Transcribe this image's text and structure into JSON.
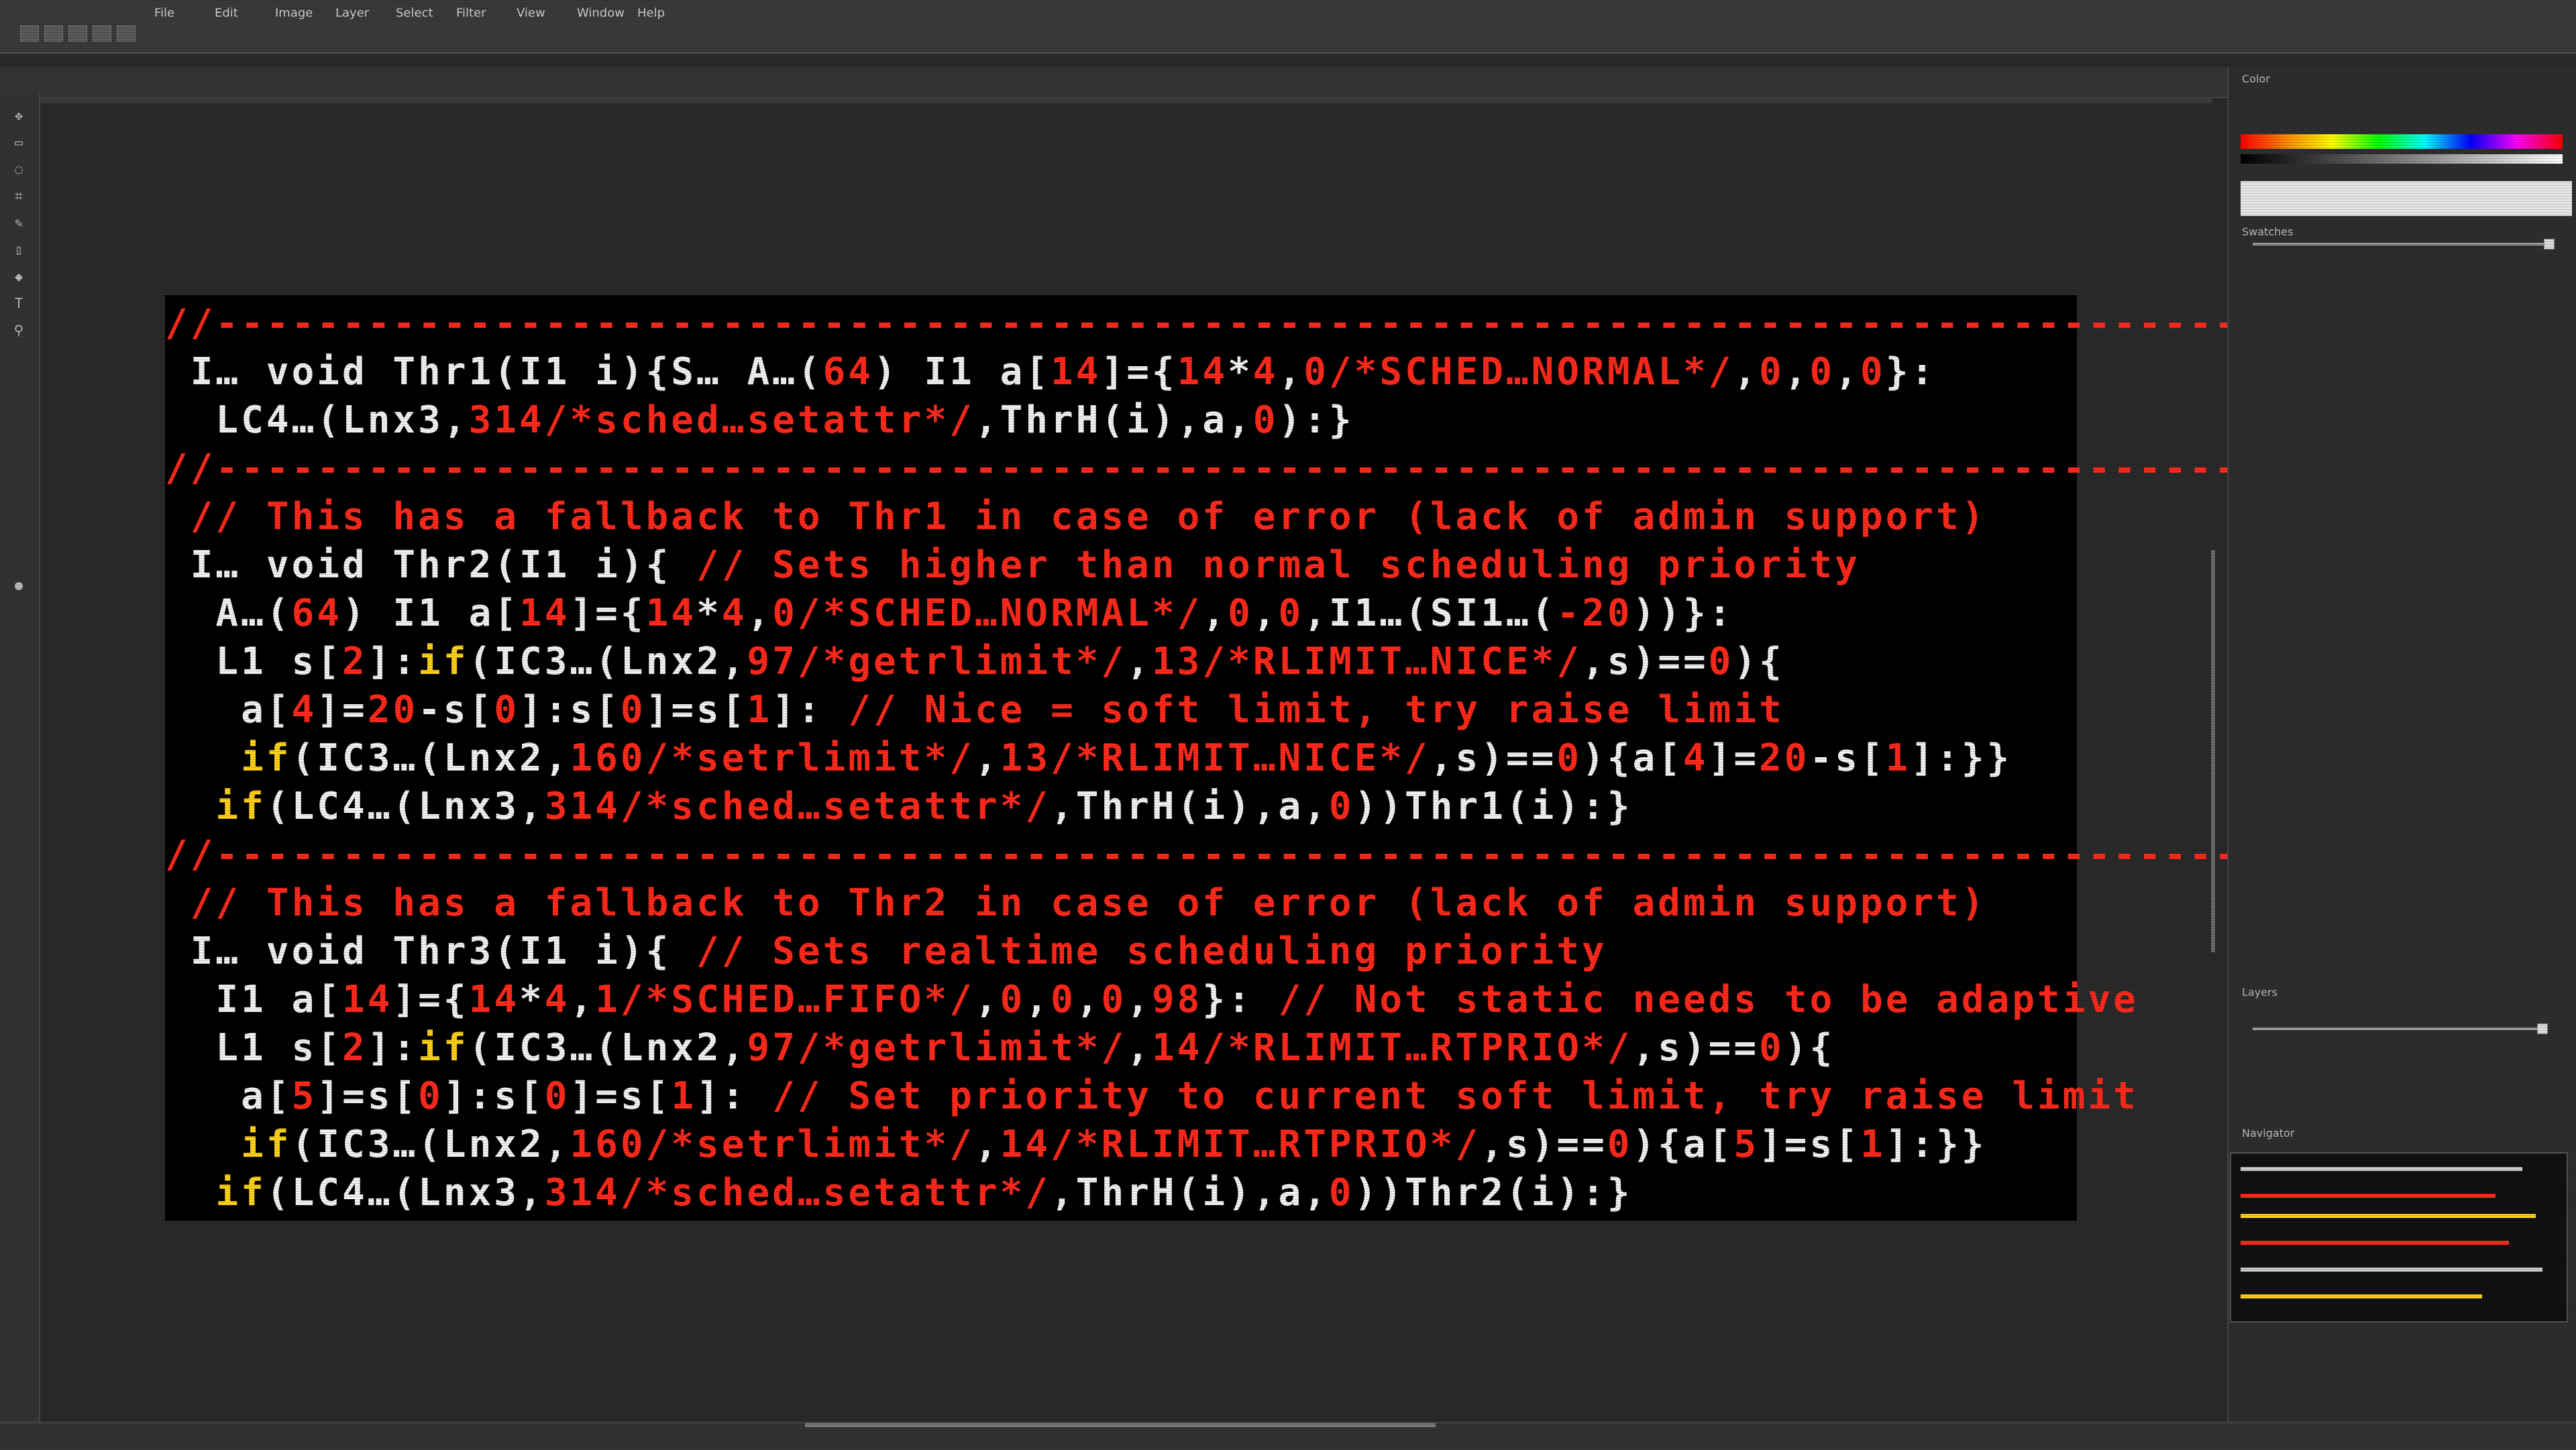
{
  "app": {
    "menu": [
      "File",
      "Edit",
      "Image",
      "Layer",
      "Select",
      "Filter",
      "View",
      "Window",
      "Help"
    ]
  },
  "panels": {
    "color": "Color",
    "swatches": "Swatches",
    "layers": "Layers",
    "navigator": "Navigator"
  },
  "colors": {
    "comment": "#ff2a1c",
    "keyword": "#ffd21a",
    "text": "#f2f2f2",
    "canvas_bg": "#000000",
    "app_bg": "#2a2a2a"
  },
  "code": {
    "lines": [
      [
        {
          "c": "r",
          "t": "//-------------------------------------------------------------------------------------"
        }
      ],
      [
        {
          "c": "w",
          "t": " I… void Thr1(I1 i){S… A…("
        },
        {
          "c": "r",
          "t": "64"
        },
        {
          "c": "w",
          "t": ") I1 a["
        },
        {
          "c": "r",
          "t": "14"
        },
        {
          "c": "w",
          "t": "]={"
        },
        {
          "c": "r",
          "t": "14"
        },
        {
          "c": "w",
          "t": "*"
        },
        {
          "c": "r",
          "t": "4"
        },
        {
          "c": "w",
          "t": ","
        },
        {
          "c": "r",
          "t": "0/*SCHED…NORMAL*/"
        },
        {
          "c": "w",
          "t": ","
        },
        {
          "c": "r",
          "t": "0"
        },
        {
          "c": "w",
          "t": ","
        },
        {
          "c": "r",
          "t": "0"
        },
        {
          "c": "w",
          "t": ","
        },
        {
          "c": "r",
          "t": "0"
        },
        {
          "c": "w",
          "t": "}:"
        }
      ],
      [
        {
          "c": "w",
          "t": "  LC4…(Lnx3,"
        },
        {
          "c": "r",
          "t": "314/*sched…setattr*/"
        },
        {
          "c": "w",
          "t": ",ThrH(i),a,"
        },
        {
          "c": "r",
          "t": "0"
        },
        {
          "c": "w",
          "t": "):}"
        }
      ],
      [
        {
          "c": "r",
          "t": "//-------------------------------------------------------------------------------------"
        }
      ],
      [
        {
          "c": "r",
          "t": " // This has a fallback to Thr1 in case of error (lack of admin support)"
        }
      ],
      [
        {
          "c": "w",
          "t": " I… void Thr2(I1 i){ "
        },
        {
          "c": "r",
          "t": "// Sets higher than normal scheduling priority"
        }
      ],
      [
        {
          "c": "w",
          "t": "  A…("
        },
        {
          "c": "r",
          "t": "64"
        },
        {
          "c": "w",
          "t": ") I1 a["
        },
        {
          "c": "r",
          "t": "14"
        },
        {
          "c": "w",
          "t": "]={"
        },
        {
          "c": "r",
          "t": "14"
        },
        {
          "c": "w",
          "t": "*"
        },
        {
          "c": "r",
          "t": "4"
        },
        {
          "c": "w",
          "t": ","
        },
        {
          "c": "r",
          "t": "0/*SCHED…NORMAL*/"
        },
        {
          "c": "w",
          "t": ","
        },
        {
          "c": "r",
          "t": "0"
        },
        {
          "c": "w",
          "t": ","
        },
        {
          "c": "r",
          "t": "0"
        },
        {
          "c": "w",
          "t": ",I1…(SI1…("
        },
        {
          "c": "r",
          "t": "-20"
        },
        {
          "c": "w",
          "t": "))}:"
        }
      ],
      [
        {
          "c": "w",
          "t": "  L1 s["
        },
        {
          "c": "r",
          "t": "2"
        },
        {
          "c": "w",
          "t": "]:"
        },
        {
          "c": "y",
          "t": "if"
        },
        {
          "c": "w",
          "t": "(IC3…(Lnx2,"
        },
        {
          "c": "r",
          "t": "97/*getrlimit*/"
        },
        {
          "c": "w",
          "t": ","
        },
        {
          "c": "r",
          "t": "13/*RLIMIT…NICE*/"
        },
        {
          "c": "w",
          "t": ",s)=="
        },
        {
          "c": "r",
          "t": "0"
        },
        {
          "c": "w",
          "t": "){"
        }
      ],
      [
        {
          "c": "w",
          "t": "   a["
        },
        {
          "c": "r",
          "t": "4"
        },
        {
          "c": "w",
          "t": "]="
        },
        {
          "c": "r",
          "t": "20"
        },
        {
          "c": "w",
          "t": "-s["
        },
        {
          "c": "r",
          "t": "0"
        },
        {
          "c": "w",
          "t": "]:s["
        },
        {
          "c": "r",
          "t": "0"
        },
        {
          "c": "w",
          "t": "]=s["
        },
        {
          "c": "r",
          "t": "1"
        },
        {
          "c": "w",
          "t": "]: "
        },
        {
          "c": "r",
          "t": "// Nice = soft limit, try raise limit"
        }
      ],
      [
        {
          "c": "y",
          "t": "   if"
        },
        {
          "c": "w",
          "t": "(IC3…(Lnx2,"
        },
        {
          "c": "r",
          "t": "160/*setrlimit*/"
        },
        {
          "c": "w",
          "t": ","
        },
        {
          "c": "r",
          "t": "13/*RLIMIT…NICE*/"
        },
        {
          "c": "w",
          "t": ",s)=="
        },
        {
          "c": "r",
          "t": "0"
        },
        {
          "c": "w",
          "t": "){a["
        },
        {
          "c": "r",
          "t": "4"
        },
        {
          "c": "w",
          "t": "]="
        },
        {
          "c": "r",
          "t": "20"
        },
        {
          "c": "w",
          "t": "-s["
        },
        {
          "c": "r",
          "t": "1"
        },
        {
          "c": "w",
          "t": "]:}}"
        }
      ],
      [
        {
          "c": "y",
          "t": "  if"
        },
        {
          "c": "w",
          "t": "(LC4…(Lnx3,"
        },
        {
          "c": "r",
          "t": "314/*sched…setattr*/"
        },
        {
          "c": "w",
          "t": ",ThrH(i),a,"
        },
        {
          "c": "r",
          "t": "0"
        },
        {
          "c": "w",
          "t": "))Thr1(i):}"
        }
      ],
      [
        {
          "c": "r",
          "t": "//-------------------------------------------------------------------------------------"
        }
      ],
      [
        {
          "c": "r",
          "t": " // This has a fallback to Thr2 in case of error (lack of admin support)"
        }
      ],
      [
        {
          "c": "w",
          "t": " I… void Thr3(I1 i){ "
        },
        {
          "c": "r",
          "t": "// Sets realtime scheduling priority"
        }
      ],
      [
        {
          "c": "w",
          "t": "  I1 a["
        },
        {
          "c": "r",
          "t": "14"
        },
        {
          "c": "w",
          "t": "]={"
        },
        {
          "c": "r",
          "t": "14"
        },
        {
          "c": "w",
          "t": "*"
        },
        {
          "c": "r",
          "t": "4"
        },
        {
          "c": "w",
          "t": ","
        },
        {
          "c": "r",
          "t": "1/*SCHED…FIFO*/"
        },
        {
          "c": "w",
          "t": ","
        },
        {
          "c": "r",
          "t": "0"
        },
        {
          "c": "w",
          "t": ","
        },
        {
          "c": "r",
          "t": "0"
        },
        {
          "c": "w",
          "t": ","
        },
        {
          "c": "r",
          "t": "0"
        },
        {
          "c": "w",
          "t": ","
        },
        {
          "c": "r",
          "t": "98"
        },
        {
          "c": "w",
          "t": "}: "
        },
        {
          "c": "r",
          "t": "// Not static needs to be adaptive"
        }
      ],
      [
        {
          "c": "w",
          "t": "  L1 s["
        },
        {
          "c": "r",
          "t": "2"
        },
        {
          "c": "w",
          "t": "]:"
        },
        {
          "c": "y",
          "t": "if"
        },
        {
          "c": "w",
          "t": "(IC3…(Lnx2,"
        },
        {
          "c": "r",
          "t": "97/*getrlimit*/"
        },
        {
          "c": "w",
          "t": ","
        },
        {
          "c": "r",
          "t": "14/*RLIMIT…RTPRIO*/"
        },
        {
          "c": "w",
          "t": ",s)=="
        },
        {
          "c": "r",
          "t": "0"
        },
        {
          "c": "w",
          "t": "){"
        }
      ],
      [
        {
          "c": "w",
          "t": "   a["
        },
        {
          "c": "r",
          "t": "5"
        },
        {
          "c": "w",
          "t": "]=s["
        },
        {
          "c": "r",
          "t": "0"
        },
        {
          "c": "w",
          "t": "]:s["
        },
        {
          "c": "r",
          "t": "0"
        },
        {
          "c": "w",
          "t": "]=s["
        },
        {
          "c": "r",
          "t": "1"
        },
        {
          "c": "w",
          "t": "]: "
        },
        {
          "c": "r",
          "t": "// Set priority to current soft limit, try raise limit"
        }
      ],
      [
        {
          "c": "y",
          "t": "   if"
        },
        {
          "c": "w",
          "t": "(IC3…(Lnx2,"
        },
        {
          "c": "r",
          "t": "160/*setrlimit*/"
        },
        {
          "c": "w",
          "t": ","
        },
        {
          "c": "r",
          "t": "14/*RLIMIT…RTPRIO*/"
        },
        {
          "c": "w",
          "t": ",s)=="
        },
        {
          "c": "r",
          "t": "0"
        },
        {
          "c": "w",
          "t": "){a["
        },
        {
          "c": "r",
          "t": "5"
        },
        {
          "c": "w",
          "t": "]=s["
        },
        {
          "c": "r",
          "t": "1"
        },
        {
          "c": "w",
          "t": "]:}}"
        }
      ],
      [
        {
          "c": "y",
          "t": "  if"
        },
        {
          "c": "w",
          "t": "(LC4…(Lnx3,"
        },
        {
          "c": "r",
          "t": "314/*sched…setattr*/"
        },
        {
          "c": "w",
          "t": ",ThrH(i),a,"
        },
        {
          "c": "r",
          "t": "0"
        },
        {
          "c": "w",
          "t": "))Thr2(i):}"
        }
      ]
    ]
  }
}
